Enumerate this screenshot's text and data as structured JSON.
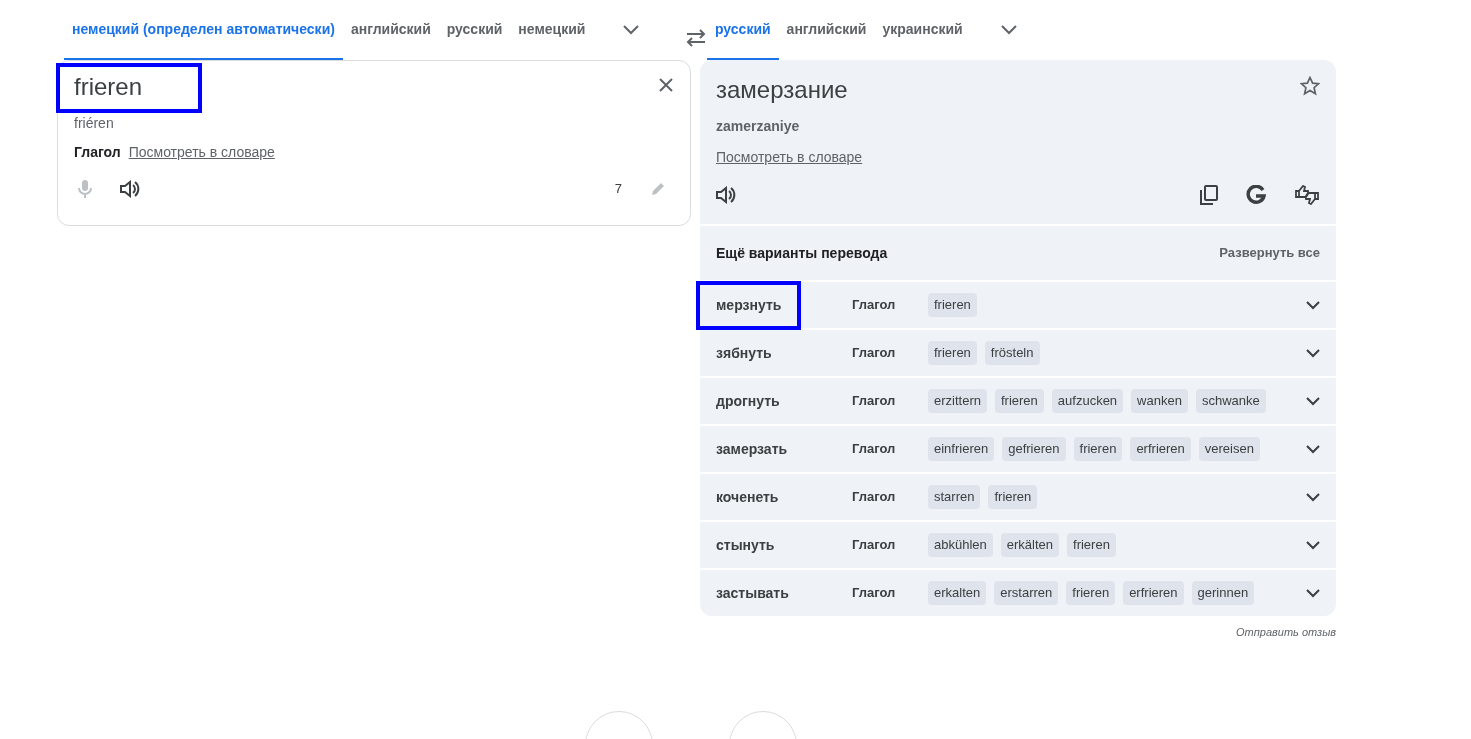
{
  "source_languages": [
    {
      "label": "немецкий (определен автоматически)",
      "selected": true
    },
    {
      "label": "английский",
      "selected": false
    },
    {
      "label": "русский",
      "selected": false
    },
    {
      "label": "немецкий",
      "selected": false
    }
  ],
  "target_languages": [
    {
      "label": "русский",
      "selected": true
    },
    {
      "label": "английский",
      "selected": false
    },
    {
      "label": "украинский",
      "selected": false
    }
  ],
  "source": {
    "text": "frieren",
    "highlighted": true,
    "transliteration": "friéren",
    "part_of_speech": "Глагол",
    "dictionary_link": "Посмотреть в словаре",
    "char_count": "7"
  },
  "translation": {
    "text": "замерзание",
    "transliteration": "zamerzaniye",
    "dictionary_link": "Посмотреть в словаре"
  },
  "more_translations": {
    "title": "Ещё варианты перевода",
    "expand_all": "Развернуть все",
    "rows": [
      {
        "word": "мерзнуть",
        "highlighted": true,
        "part_of_speech": "Глагол",
        "synonyms": [
          "frieren"
        ]
      },
      {
        "word": "зябнуть",
        "highlighted": false,
        "part_of_speech": "Глагол",
        "synonyms": [
          "frieren",
          "frösteln"
        ]
      },
      {
        "word": "дрогнуть",
        "highlighted": false,
        "part_of_speech": "Глагол",
        "synonyms": [
          "erzittern",
          "frieren",
          "aufzucken",
          "wanken",
          "schwanke"
        ]
      },
      {
        "word": "замерзать",
        "highlighted": false,
        "part_of_speech": "Глагол",
        "synonyms": [
          "einfrieren",
          "gefrieren",
          "frieren",
          "erfrieren",
          "vereisen"
        ]
      },
      {
        "word": "коченеть",
        "highlighted": false,
        "part_of_speech": "Глагол",
        "synonyms": [
          "starren",
          "frieren"
        ]
      },
      {
        "word": "стынуть",
        "highlighted": false,
        "part_of_speech": "Глагол",
        "synonyms": [
          "abkühlen",
          "erkälten",
          "frieren"
        ]
      },
      {
        "word": "застывать",
        "highlighted": false,
        "part_of_speech": "Глагол",
        "synonyms": [
          "erkalten",
          "erstarren",
          "frieren",
          "erfrieren",
          "gerinnen"
        ]
      }
    ]
  },
  "feedback_link": "Отправить отзыв"
}
